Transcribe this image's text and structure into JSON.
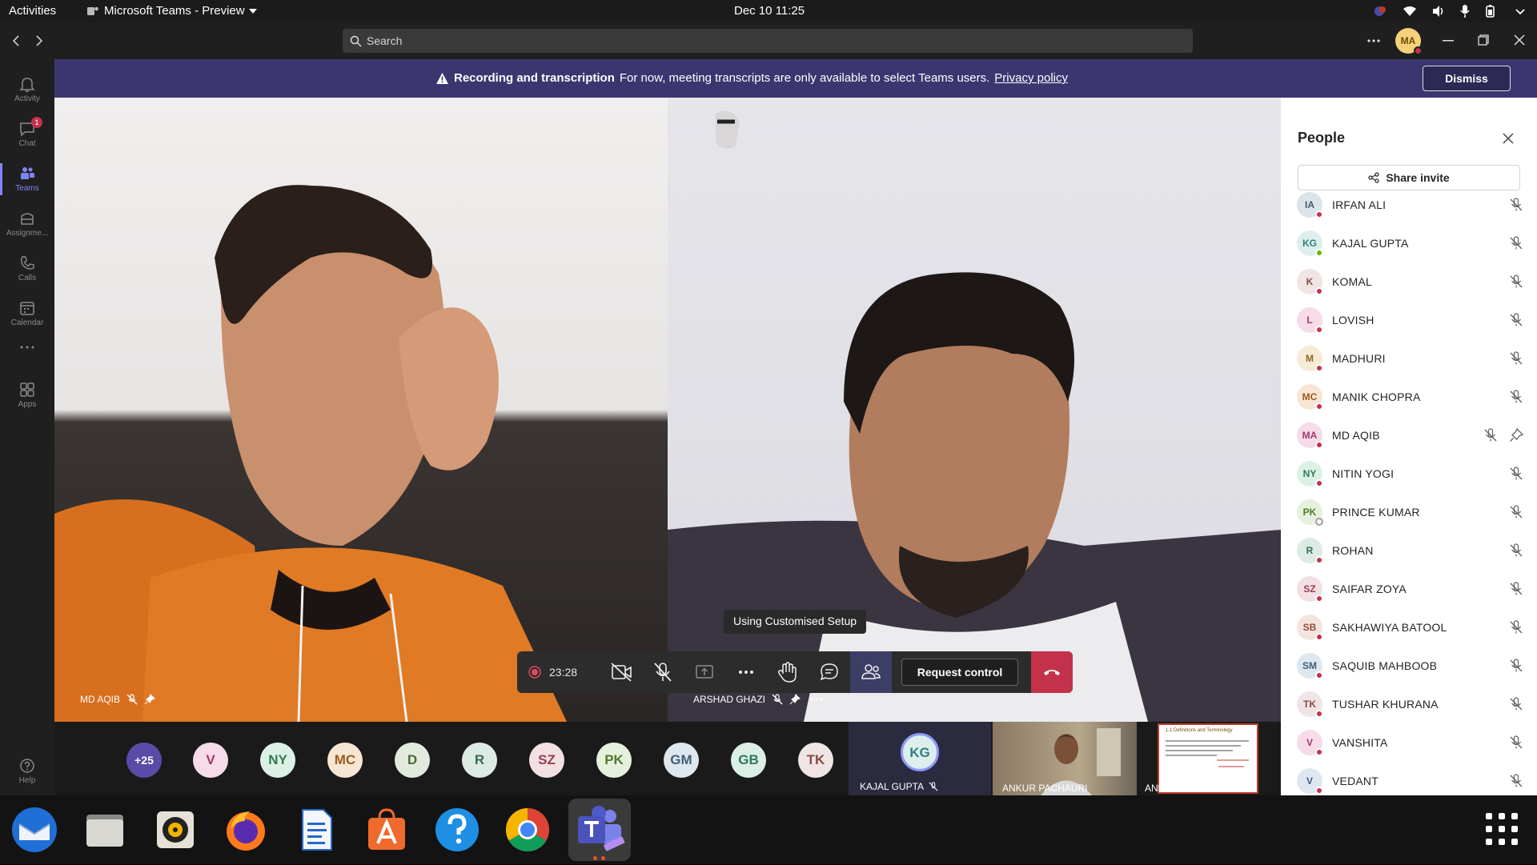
{
  "system_bar": {
    "activities": "Activities",
    "app_menu": "Microsoft Teams - Preview",
    "clock": "Dec 10  11:25"
  },
  "teams_header": {
    "search_placeholder": "Search",
    "avatar_initials": "MA"
  },
  "rail": [
    {
      "label": "Activity",
      "icon": "bell-icon"
    },
    {
      "label": "Chat",
      "icon": "chat-icon",
      "badge": "1"
    },
    {
      "label": "Teams",
      "icon": "teams-icon"
    },
    {
      "label": "Assignme...",
      "icon": "assignments-icon"
    },
    {
      "label": "Calls",
      "icon": "phone-icon"
    },
    {
      "label": "Calendar",
      "icon": "calendar-icon"
    },
    {
      "label": "...",
      "icon": "more-icon"
    },
    {
      "label": "Apps",
      "icon": "apps-icon"
    },
    {
      "label": "Help",
      "icon": "help-icon"
    }
  ],
  "banner": {
    "title": "Recording and transcription",
    "text": "For now, meeting transcripts are only available to select Teams users.",
    "link": "Privacy policy",
    "dismiss": "Dismiss"
  },
  "videos": {
    "left_name": "MD AQIB",
    "right_name": "ARSHAD GHAZI"
  },
  "controls": {
    "timer": "23:28",
    "tooltip": "Using Customised Setup",
    "request_control": "Request control"
  },
  "people_panel": {
    "title": "People",
    "share_invite": "Share invite",
    "participants": [
      {
        "initials": "IA",
        "name": "IRFAN ALI",
        "bg": "#dbe4e9",
        "fg": "#445b6b",
        "status": "#c4314b"
      },
      {
        "initials": "KG",
        "name": "KAJAL GUPTA",
        "bg": "#dcefee",
        "fg": "#317f7a",
        "status": "#6bb700"
      },
      {
        "initials": "K",
        "name": "KOMAL",
        "bg": "#f0e4e4",
        "fg": "#8a4a4a",
        "status": "#c4314b"
      },
      {
        "initials": "L",
        "name": "LOVISH",
        "bg": "#f6dbe8",
        "fg": "#a2386f",
        "status": "#c4314b"
      },
      {
        "initials": "M",
        "name": "MADHURI",
        "bg": "#f5ebd6",
        "fg": "#8a6a1f",
        "status": "#c4314b"
      },
      {
        "initials": "MC",
        "name": "MANIK CHOPRA",
        "bg": "#f7e6d3",
        "fg": "#9a5b1e",
        "status": "#c4314b"
      },
      {
        "initials": "MA",
        "name": "MD AQIB",
        "bg": "#f6dbe8",
        "fg": "#a2386f",
        "status": "#c4314b"
      },
      {
        "initials": "NY",
        "name": "NITIN YOGI",
        "bg": "#dcf1e6",
        "fg": "#2f7a50",
        "status": "#c4314b"
      },
      {
        "initials": "PK",
        "name": "PRINCE KUMAR",
        "bg": "#e6f1dd",
        "fg": "#4f7a2b",
        "status": "#ffffff"
      },
      {
        "initials": "R",
        "name": "ROHAN",
        "bg": "#dcebe4",
        "fg": "#3b6a55",
        "status": "#c4314b"
      },
      {
        "initials": "SZ",
        "name": "SAIFAR ZOYA",
        "bg": "#f3e0e3",
        "fg": "#9a3e4f",
        "status": "#c4314b"
      },
      {
        "initials": "SB",
        "name": "SAKHAWIYA BATOOL",
        "bg": "#f4e4dd",
        "fg": "#8f4f36",
        "status": "#c4314b"
      },
      {
        "initials": "SM",
        "name": "SAQUIB MAHBOOB",
        "bg": "#dfe7ee",
        "fg": "#3f5f7a",
        "status": "#c4314b"
      },
      {
        "initials": "TK",
        "name": "TUSHAR KHURANA",
        "bg": "#f0e4e4",
        "fg": "#8a4a4a",
        "status": "#c4314b"
      },
      {
        "initials": "V",
        "name": "VANSHITA",
        "bg": "#f6dbe8",
        "fg": "#a2386f",
        "status": "#c4314b"
      },
      {
        "initials": "V",
        "name": "VEDANT",
        "bg": "#dfe7f2",
        "fg": "#3d5a8a",
        "status": "#c4314b"
      }
    ]
  },
  "strip": {
    "overflow": "+25",
    "avatars": [
      {
        "initials": "V",
        "bg": "#f6dbe8",
        "fg": "#a2386f"
      },
      {
        "initials": "NY",
        "bg": "#dcf1e6",
        "fg": "#2f7a50"
      },
      {
        "initials": "MC",
        "bg": "#f7e6d3",
        "fg": "#9a5b1e"
      },
      {
        "initials": "D",
        "bg": "#e2eadd",
        "fg": "#4b6a3a"
      },
      {
        "initials": "R",
        "bg": "#dcebe4",
        "fg": "#3b6a55"
      },
      {
        "initials": "SZ",
        "bg": "#f3e0e3",
        "fg": "#9a3e4f"
      },
      {
        "initials": "PK",
        "bg": "#e6f1dd",
        "fg": "#4f7a2b"
      },
      {
        "initials": "GM",
        "bg": "#dfe7ee",
        "fg": "#3f5f7a"
      },
      {
        "initials": "GB",
        "bg": "#dcefe6",
        "fg": "#2f7a58"
      },
      {
        "initials": "TK",
        "bg": "#f0e4e4",
        "fg": "#8a4a4a"
      }
    ],
    "active_initials": "KG",
    "active_name": "KAJAL GUPTA",
    "video_name_1": "ANKUR PACHAURI",
    "video_name_2": "ANKUR PACHAURI",
    "slide_title": "1.1 Definitions and Terminology"
  },
  "dock": [
    "thunderbird",
    "files",
    "rhythmbox",
    "firefox",
    "writer",
    "software",
    "help",
    "chrome",
    "teams"
  ],
  "colors": {
    "accent": "#5b5fc7",
    "banner": "#3b3670",
    "end_call": "#c4314b"
  }
}
